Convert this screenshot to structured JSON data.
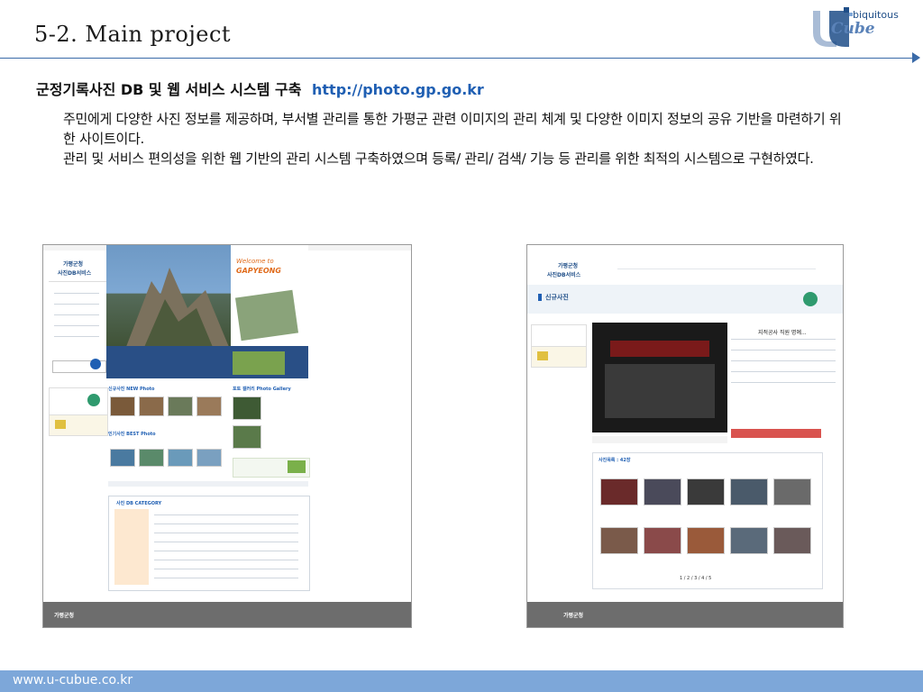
{
  "slide": {
    "title": "5-2. Main project",
    "logo": {
      "tagline": "biquitous",
      "word": "Cube"
    },
    "heading": "군정기록사진 DB 및 웹 서비스 시스템 구축",
    "heading_url": "http://photo.gp.go.kr",
    "paragraphs": [
      "주민에게 다양한 사진 정보를 제공하며, 부서별 관리를 통한 가평군 관련 이미지의 관리 체계 및 다양한 이미지 정보의 공유 기반을 마련하기 위한 사이트이다.",
      "관리 및 서비스 편의성을 위한 웹 기반의 관리 시스템 구축하였으며 등록/ 관리/ 검색/ 기능 등 관리를 위한 최적의 시스템으로 구현하였다."
    ],
    "footer_url": "www.u-cubue.co.kr"
  },
  "left_shot": {
    "brand": "가평군청",
    "service": "사진DB서비스",
    "welcome": "Welcome to",
    "gapyeong": "GAPYEONG",
    "new_photo": "신규사진 NEW Photo",
    "gallery": "포토 갤러리 Photo Gallery",
    "best": "인기사진 BEST Photo",
    "category": "사진 DB CATEGORY",
    "footer_brand": "가평군청"
  },
  "right_shot": {
    "brand": "가평군청",
    "service": "사진DB서비스",
    "section": "신규사진",
    "photo_title": "지적공사 직원 명예...",
    "list_header": "사진목록 : 42장",
    "pager": "1 / 2 / 3 / 4 / 5",
    "footer_brand": "가평군청"
  },
  "colors": {
    "accent": "#3a6aa8",
    "footer": "#7da7d9",
    "url": "#1f5fb3"
  }
}
